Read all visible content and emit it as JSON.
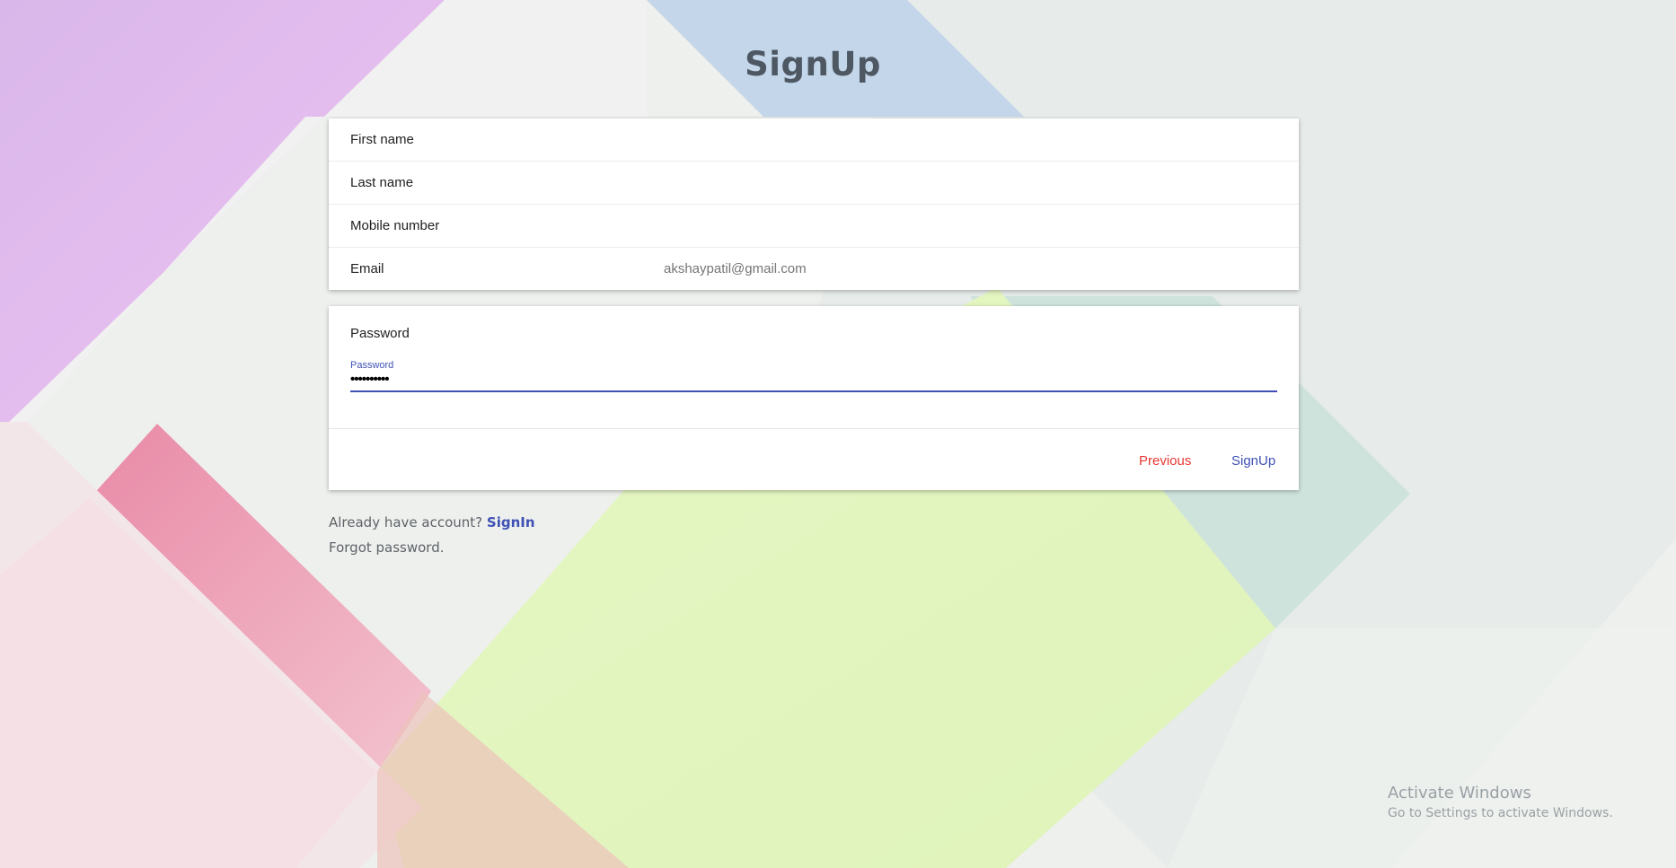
{
  "page": {
    "title": "SignUp"
  },
  "summary": {
    "rows": [
      {
        "label": "First name",
        "value": ""
      },
      {
        "label": "Last name",
        "value": ""
      },
      {
        "label": "Mobile number",
        "value": ""
      },
      {
        "label": "Email",
        "value": "akshaypatil@gmail.com"
      }
    ]
  },
  "password_section": {
    "heading": "Password",
    "field_label": "Password",
    "field_value": "••••••••••"
  },
  "actions": {
    "previous_label": "Previous",
    "signup_label": "SignUp"
  },
  "footer_links": {
    "already_text": "Already have account? ",
    "signin_label": "SignIn",
    "forgot_label": "Forgot password."
  },
  "os_watermark": {
    "line1": "Activate Windows",
    "line2": "Go to Settings to activate Windows."
  },
  "colors": {
    "accent": "#3f51b5",
    "danger": "#e53935",
    "title": "#4d5863"
  }
}
